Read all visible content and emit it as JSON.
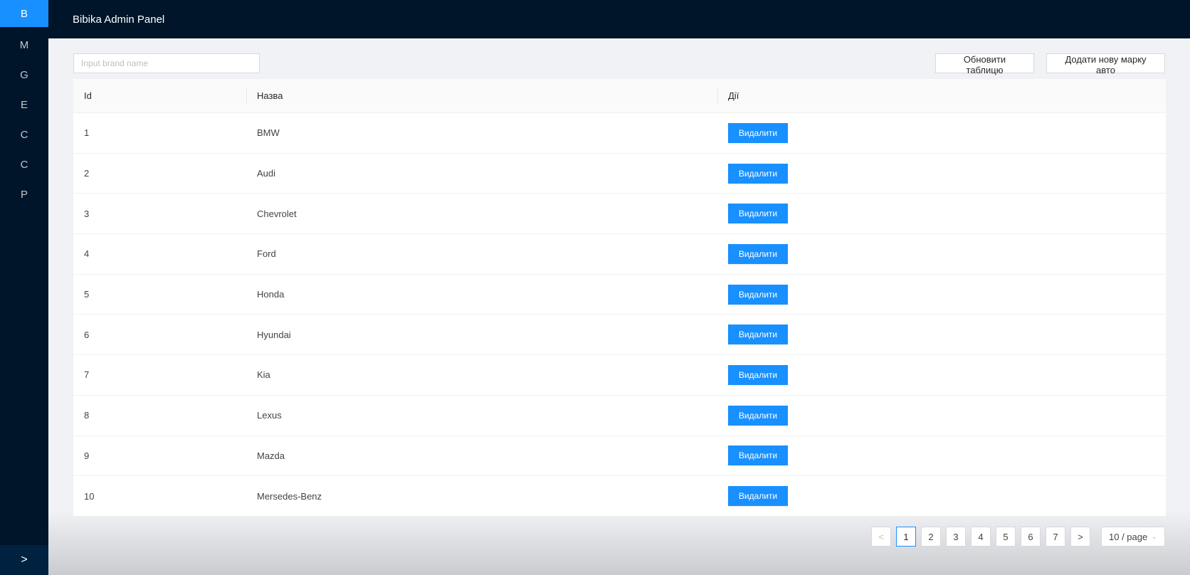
{
  "sidebar": {
    "items": [
      {
        "label": "B"
      },
      {
        "label": "M"
      },
      {
        "label": "G"
      },
      {
        "label": "E"
      },
      {
        "label": "C"
      },
      {
        "label": "C"
      },
      {
        "label": "P"
      }
    ],
    "trigger": ">"
  },
  "header": {
    "title": "Bibika Admin Panel"
  },
  "toolbar": {
    "search_placeholder": "Input brand name",
    "refresh_label": "Обновити таблицю",
    "add_label": "Додати нову марку авто"
  },
  "table": {
    "columns": [
      "Id",
      "Назва",
      "Дії"
    ],
    "delete_label": "Видалити",
    "rows": [
      {
        "id": "1",
        "name": "BMW"
      },
      {
        "id": "2",
        "name": "Audi"
      },
      {
        "id": "3",
        "name": "Chevrolet"
      },
      {
        "id": "4",
        "name": "Ford"
      },
      {
        "id": "5",
        "name": "Honda"
      },
      {
        "id": "6",
        "name": "Hyundai"
      },
      {
        "id": "7",
        "name": "Kia"
      },
      {
        "id": "8",
        "name": "Lexus"
      },
      {
        "id": "9",
        "name": "Mazda"
      },
      {
        "id": "10",
        "name": "Mersedes-Benz"
      }
    ]
  },
  "pagination": {
    "prev": "<",
    "next": ">",
    "pages": [
      "1",
      "2",
      "3",
      "4",
      "5",
      "6",
      "7"
    ],
    "current": "1",
    "page_size": "10 / page",
    "accent": "#1890ff"
  },
  "colors": {
    "sidebar_bg": "#001529",
    "primary": "#1890ff"
  }
}
